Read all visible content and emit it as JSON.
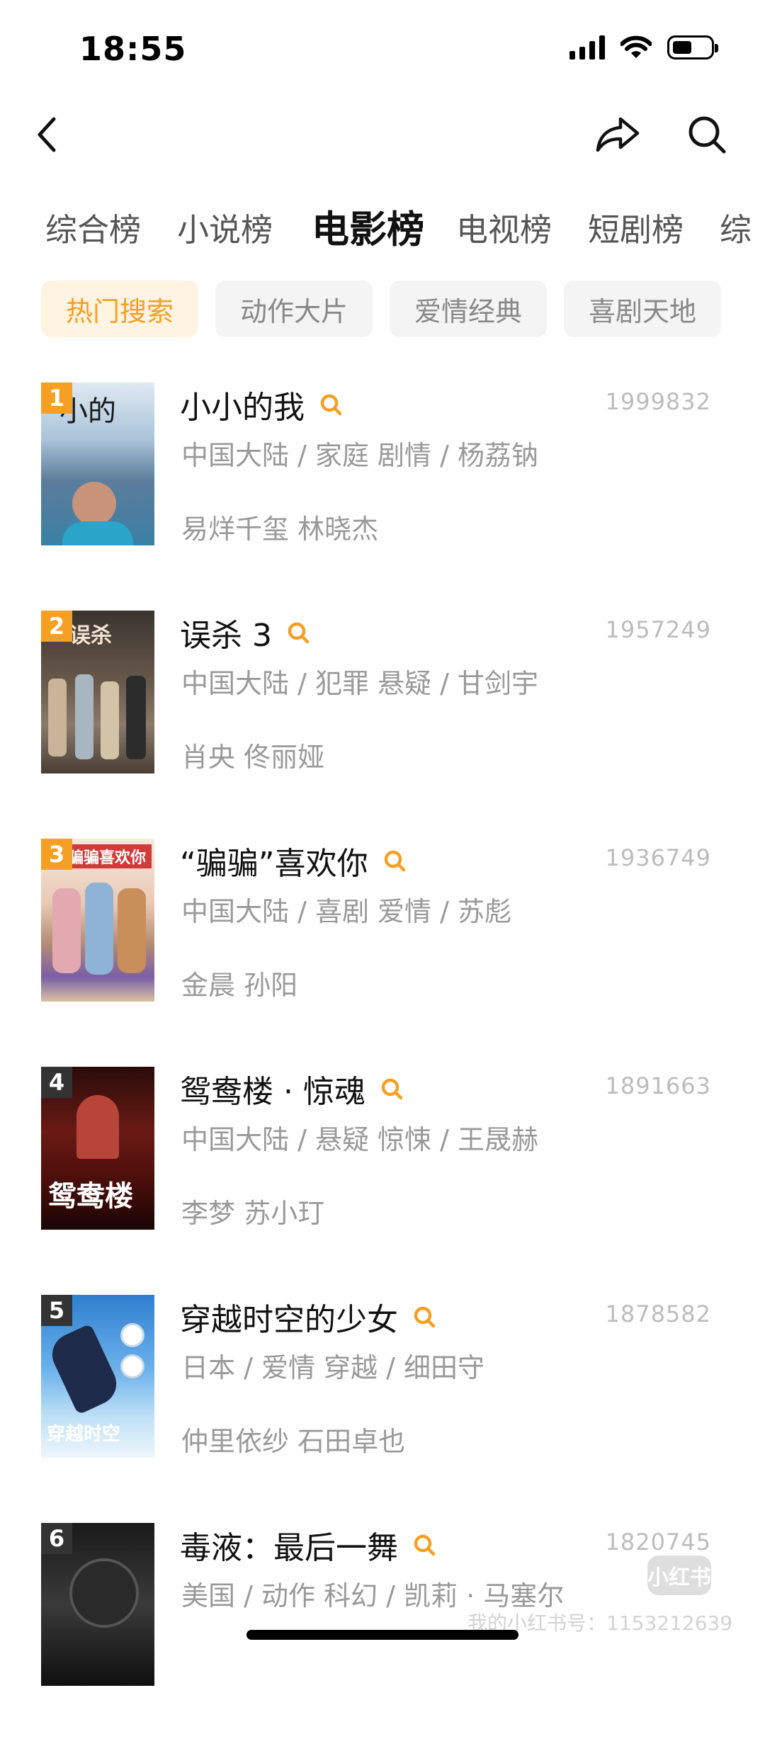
{
  "status_bar": {
    "time": "18:55"
  },
  "nav": {
    "back": "back-icon",
    "share": "share-icon",
    "search": "search-icon"
  },
  "tabs": [
    "综合榜",
    "小说榜",
    "电影榜",
    "电视榜",
    "短剧榜",
    "综"
  ],
  "active_tab": "电影榜",
  "chips": [
    "热门搜索",
    "动作大片",
    "爱情经典",
    "喜剧天地"
  ],
  "active_chip": "热门搜索",
  "items": [
    {
      "rank": "1",
      "title": "小小的我",
      "score": "1999832",
      "meta": "中国大陆 / 家庭 剧情 / 杨荔钠",
      "cast": "易烊千玺 林晓杰"
    },
    {
      "rank": "2",
      "title": "误杀 3",
      "score": "1957249",
      "meta": "中国大陆 / 犯罪 悬疑 / 甘剑宇",
      "cast": "肖央 佟丽娅"
    },
    {
      "rank": "3",
      "title": "“骗骗”喜欢你",
      "score": "1936749",
      "meta": "中国大陆 / 喜剧 爱情 / 苏彪",
      "cast": "金晨 孙阳"
    },
    {
      "rank": "4",
      "title": "鸳鸯楼 · 惊魂",
      "score": "1891663",
      "meta": "中国大陆 / 悬疑 惊悚 / 王晟赫",
      "cast": "李梦 苏小玎"
    },
    {
      "rank": "5",
      "title": "穿越时空的少女",
      "score": "1878582",
      "meta": "日本 / 爱情 穿越 / 细田守",
      "cast": "仲里依纱 石田卓也"
    },
    {
      "rank": "6",
      "title": "毒液：最后一舞",
      "score": "1820745",
      "meta": "美国 / 动作 科幻 / 凯莉 · 马塞尔",
      "cast": ""
    }
  ],
  "watermark": {
    "logo": "小红书",
    "text": "我的小红书号：1153212639"
  },
  "colors": {
    "accent": "#f5a024",
    "chip_active_bg": "#fff3e2",
    "rank_top": "#f5a024",
    "rank_other": "#333333"
  }
}
